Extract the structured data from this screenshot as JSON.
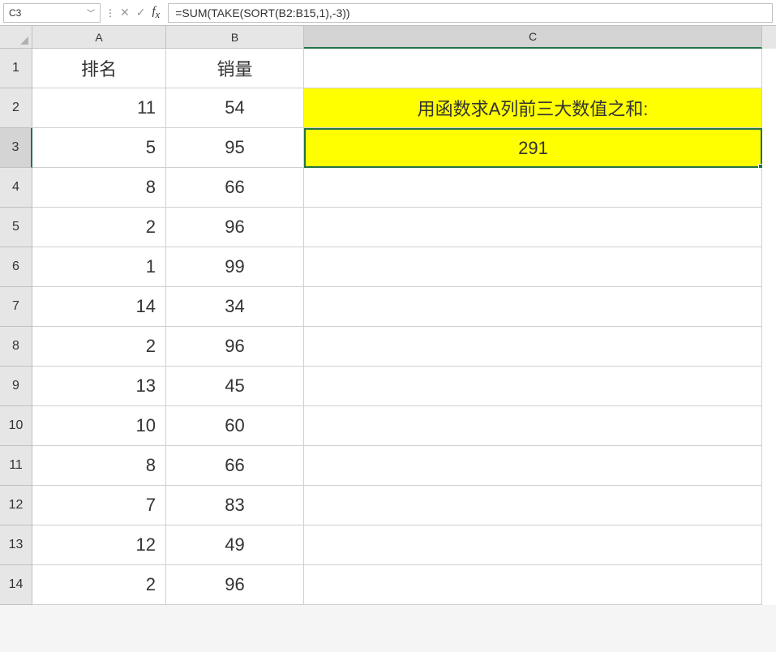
{
  "name_box": "C3",
  "formula": "=SUM(TAKE(SORT(B2:B15,1),-3))",
  "columns": [
    "A",
    "B",
    "C"
  ],
  "headers": {
    "a": "排名",
    "b": "销量"
  },
  "c2_text": "用函数求A列前三大数值之和:",
  "c3_value": "291",
  "rows": [
    {
      "n": "1",
      "a": "排名",
      "b": "销量",
      "is_header": true
    },
    {
      "n": "2",
      "a": "11",
      "b": "54"
    },
    {
      "n": "3",
      "a": "5",
      "b": "95"
    },
    {
      "n": "4",
      "a": "8",
      "b": "66"
    },
    {
      "n": "5",
      "a": "2",
      "b": "96"
    },
    {
      "n": "6",
      "a": "1",
      "b": "99"
    },
    {
      "n": "7",
      "a": "14",
      "b": "34"
    },
    {
      "n": "8",
      "a": "2",
      "b": "96"
    },
    {
      "n": "9",
      "a": "13",
      "b": "45"
    },
    {
      "n": "10",
      "a": "10",
      "b": "60"
    },
    {
      "n": "11",
      "a": "8",
      "b": "66"
    },
    {
      "n": "12",
      "a": "7",
      "b": "83"
    },
    {
      "n": "13",
      "a": "12",
      "b": "49"
    },
    {
      "n": "14",
      "a": "2",
      "b": "96"
    }
  ],
  "chart_data": {
    "type": "table",
    "title": "用函数求A列前三大数值之和",
    "columns": [
      "排名",
      "销量"
    ],
    "data": [
      [
        11,
        54
      ],
      [
        5,
        95
      ],
      [
        8,
        66
      ],
      [
        2,
        96
      ],
      [
        1,
        99
      ],
      [
        14,
        34
      ],
      [
        2,
        96
      ],
      [
        13,
        45
      ],
      [
        10,
        60
      ],
      [
        8,
        66
      ],
      [
        7,
        83
      ],
      [
        12,
        49
      ],
      [
        2,
        96
      ]
    ],
    "result_label": "用函数求A列前三大数值之和:",
    "result_value": 291,
    "formula": "=SUM(TAKE(SORT(B2:B15,1),-3))"
  }
}
